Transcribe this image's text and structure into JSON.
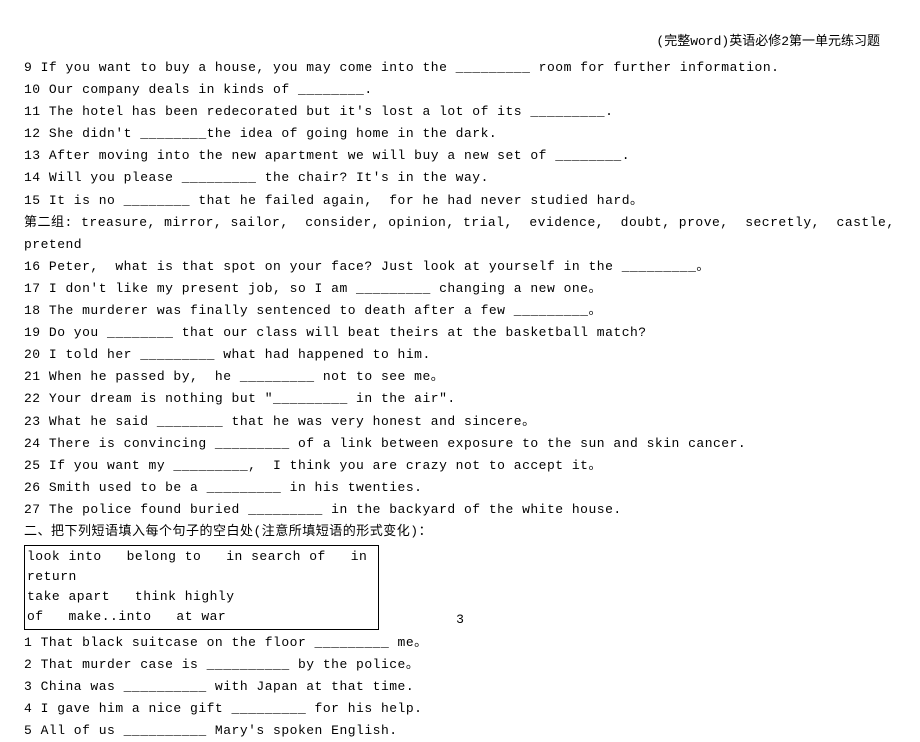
{
  "header": "(完整word)英语必修2第一单元练习题",
  "lines": [
    "9 If you want to buy a house, you may come into the _________ room for further information.",
    "10 Our company deals in kinds of ________.",
    "11 The hotel has been redecorated but it's lost a lot of its _________.",
    "12 She didn't ________the idea of going home in the dark.",
    "13 After moving into the new apartment we will buy a new set of ________.",
    "14 Will you please _________ the chair? It's in the way.",
    "15 It is no ________ that he failed again,  for he had never studied hard。",
    "第二组: treasure, mirror, sailor,  consider, opinion, trial,  evidence,  doubt, prove,  secretly,  castle,  pretend",
    "16 Peter,  what is that spot on your face? Just look at yourself in the _________。",
    "17 I don't like my present job, so I am _________ changing a new one。",
    "18 The murderer was finally sentenced to death after a few _________。",
    "19 Do you ________ that our class will beat theirs at the basketball match?",
    "20 I told her _________ what had happened to him.",
    "21 When he passed by,  he _________ not to see me。",
    "22 Your dream is nothing but \"_________ in the air\".",
    "23 What he said ________ that he was very honest and sincere。",
    "24 There is convincing _________ of a link between exposure to the sun and skin cancer.",
    "25 If you want my _________,  I think you are crazy not to accept it。",
    "26 Smith used to be a _________ in his twenties.",
    "27 The police found buried _________ in the backyard of the white house.",
    "二、把下列短语填入每个句子的空白处(注意所填短语的形式变化)："
  ],
  "boxLines": [
    "look into   belong to   in search of   in ",
    "return",
    "take apart   think highly ",
    "of   make..into   at war"
  ],
  "lines2": [
    "1 That black suitcase on the floor _________ me。",
    "2 That murder case is __________ by the police。",
    "3 China was __________ with Japan at that time.",
    "4 I gave him a nice gift _________ for his help.",
    "5 All of us __________ Mary's spoken English."
  ],
  "pageNum": "3"
}
